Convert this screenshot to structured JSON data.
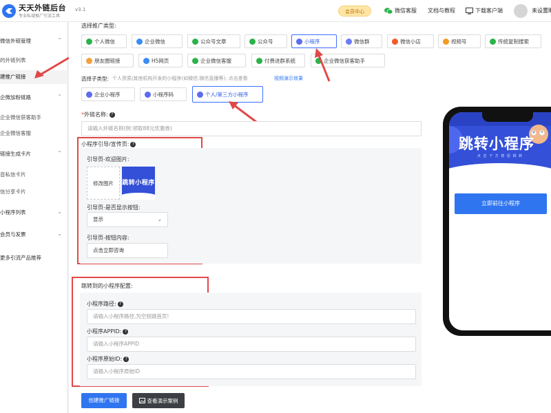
{
  "header": {
    "brand": "天天外链后台",
    "brand_sub": "专业私域推广引流工具",
    "version": "v3.1",
    "member_btn": "会员中心",
    "wechat_service": "微信客服",
    "docs": "文档与教程",
    "download": "下载客户端",
    "login": "未设置昵"
  },
  "sidebar": {
    "items": [
      {
        "label": "微信外链管理",
        "type": "group"
      },
      {
        "label": "的外链列表",
        "type": "item"
      },
      {
        "label": "建推广链接",
        "type": "item",
        "active": true
      },
      {
        "label": "企微加粉链路",
        "type": "group"
      },
      {
        "label": "企业微信获客助手",
        "type": "item"
      },
      {
        "label": "企业微信客服",
        "type": "item"
      },
      {
        "label": "链接生成卡片",
        "type": "group"
      },
      {
        "label": "音私信卡片",
        "type": "item"
      },
      {
        "label": "信分享卡片",
        "type": "item"
      },
      {
        "label": "小程序列表",
        "type": "group"
      },
      {
        "label": "会员与发票",
        "type": "group"
      },
      {
        "label": "更多引流产品推荐",
        "type": "group"
      }
    ]
  },
  "form": {
    "type_label": "选择推广类型:",
    "types": [
      {
        "label": "个人微信",
        "icon": "wechat-icon",
        "color": "#2bb34a"
      },
      {
        "label": "企业微信",
        "icon": "wecom-icon",
        "color": "#3b8cf5"
      },
      {
        "label": "公众号文章",
        "icon": "official-account-icon",
        "color": "#2bb34a"
      },
      {
        "label": "公众号",
        "icon": "official-account-icon",
        "color": "#2bb34a"
      },
      {
        "label": "小程序",
        "icon": "mini-program-icon",
        "color": "#5b6cf0",
        "selected": true
      },
      {
        "label": "微信群",
        "icon": "wechat-group-icon",
        "color": "#6b7cf6"
      },
      {
        "label": "微信小店",
        "icon": "shop-icon",
        "color": "#f25a2b"
      },
      {
        "label": "视频号",
        "icon": "channels-icon",
        "color": "#f59a23"
      },
      {
        "label": "传统复制搜索",
        "icon": "search-icon",
        "color": "#2bb34a"
      },
      {
        "label": "朋友圈链接",
        "icon": "moments-icon",
        "color": "#f2a03a"
      },
      {
        "label": "H5网页",
        "icon": "h5-icon",
        "color": "#3b8cf5"
      },
      {
        "label": "企业微信客服",
        "icon": "customer-service-icon",
        "color": "#2bb34a"
      },
      {
        "label": "付费进群系统",
        "icon": "paid-group-icon",
        "color": "#2bb34a"
      },
      {
        "label": "企业微信获客助手",
        "icon": "acquisition-icon",
        "color": "#2bb34a"
      }
    ],
    "subtype_label": "选择子类型:",
    "subtype_hint": "个人资质/其他机构开发的小程序(如微信,微信直播等); 点击查看",
    "subtype_link": "视频演示效果",
    "subtypes": [
      {
        "label": "企业小程序"
      },
      {
        "label": "小程序码"
      },
      {
        "label": "个人/第三方小程序",
        "selected": true
      }
    ],
    "name_label": "外链名称:",
    "name_placeholder": "请输入外链名称(例:领取88元优惠券)",
    "guide_label": "小程序引导/宣传页:",
    "guide_image_label": "引导页-欢迎图片:",
    "change_image": "修改图片",
    "thumb_text": "跳转小程序",
    "show_button_label": "引导页-是否显示按钮:",
    "show_button_value": "显示",
    "button_content_label": "引导页-按钮内容:",
    "button_content_value": "点击立即咨询",
    "config_label": "跳转到的小程序配置:",
    "path_label": "小程序路径:",
    "path_placeholder": "请输入小程序路径,为空则跳首页!",
    "appid_label": "小程序APPID:",
    "appid_placeholder": "请输入小程序APPID",
    "origin_label": "小程序原始ID:",
    "origin_placeholder": "请输入小程序原始ID",
    "create_btn": "创建推广链接",
    "demo_btn": "查看演示案例"
  },
  "preview": {
    "title": "跳转小程序",
    "subtitle": "点 击 下 方 按 钮 跳 转",
    "button": "立即前往小程序"
  },
  "colors": {
    "accent": "#2f75f0",
    "annotation_red": "#e04848",
    "banner_blue": "#3450d8"
  }
}
